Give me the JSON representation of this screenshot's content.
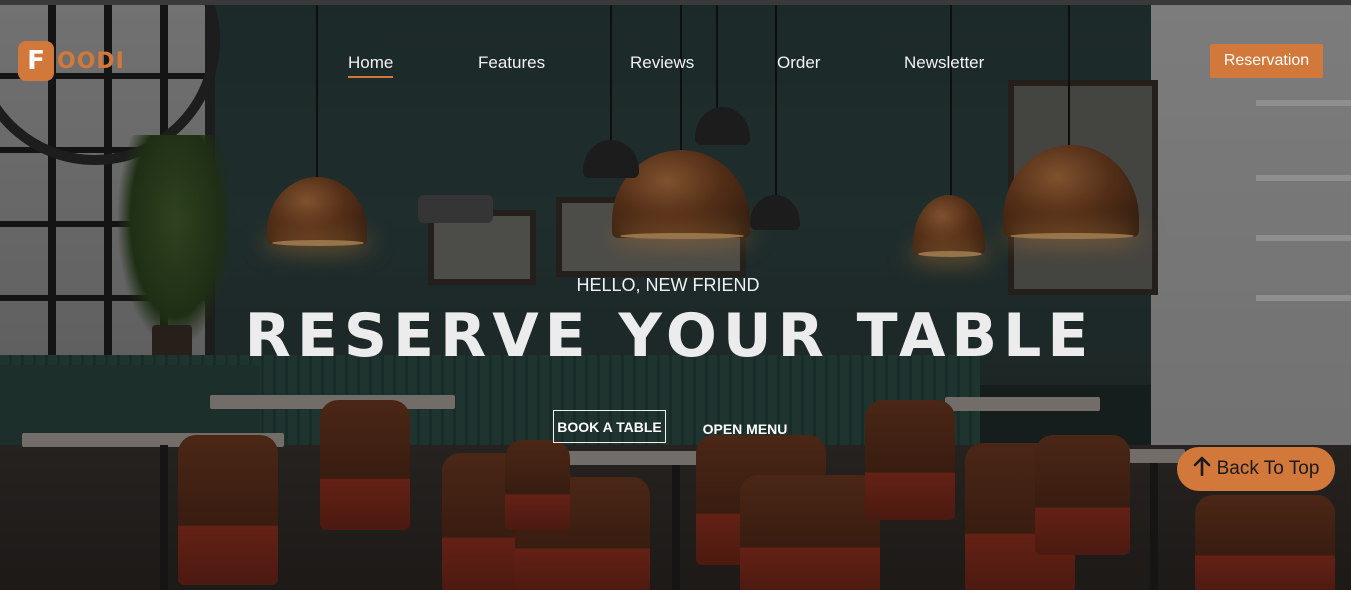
{
  "logo": {
    "badge_letter": "F",
    "text": "OODI",
    "color": "#d2783b"
  },
  "nav": {
    "items": [
      {
        "label": "Home",
        "active": true
      },
      {
        "label": "Features",
        "active": false
      },
      {
        "label": "Reviews",
        "active": false
      },
      {
        "label": "Order",
        "active": false
      },
      {
        "label": "Newsletter",
        "active": false
      }
    ],
    "reservation_label": "Reservation"
  },
  "hero": {
    "eyebrow": "HELLO, NEW FRIEND",
    "title": "RESERVE YOUR TABLE",
    "book_label": "BOOK A TABLE",
    "menu_label": "OPEN MENU"
  },
  "back_to_top": {
    "label": "Back To Top",
    "icon": "arrow-up-icon"
  },
  "colors": {
    "accent": "#d2783b",
    "text": "#f2f2f2"
  }
}
